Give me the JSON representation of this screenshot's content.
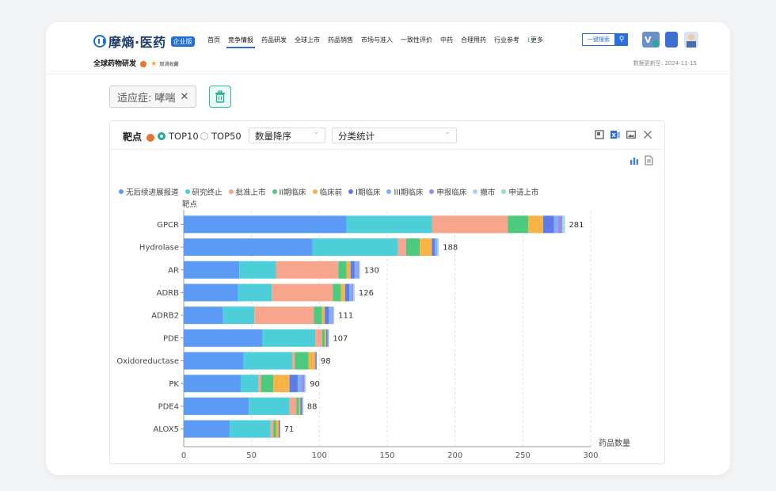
{
  "brand": {
    "name": "摩熵·医药",
    "badge": "企业版"
  },
  "nav": {
    "items": [
      "首页",
      "竞争情报",
      "药品研发",
      "全球上市",
      "药品销售",
      "市场与准入",
      "一致性评价",
      "中药",
      "合理用药",
      "行业参考"
    ],
    "more": "更多",
    "active_index": 1
  },
  "search": {
    "label": "一键搜索"
  },
  "subheader": {
    "title": "全球药物研发",
    "favorite": "取消收藏",
    "update_label": "数据更新至: 2024-11-15"
  },
  "filter": {
    "tag": "适应症: 哮喘"
  },
  "panel": {
    "title": "靶点",
    "radios": [
      "TOP10",
      "TOP50"
    ],
    "radio_selected": "TOP10",
    "sort_select": "数量降序",
    "stat_select": "分类统计"
  },
  "chart_data": {
    "type": "bar",
    "orientation": "horizontal",
    "stacked": true,
    "ylabel": "靶点",
    "xlabel": "药品数量",
    "xlim": [
      0,
      300
    ],
    "xticks": [
      0,
      50,
      100,
      150,
      200,
      250,
      300
    ],
    "categories": [
      "GPCR",
      "Hydrolase",
      "AR",
      "ADRB",
      "ADRB2",
      "PDE",
      "Oxidoreductase",
      "PK",
      "PDE4",
      "ALOX5"
    ],
    "totals": [
      281,
      188,
      130,
      126,
      111,
      107,
      98,
      90,
      88,
      71
    ],
    "legend_position": "top",
    "series": [
      {
        "name": "无后续进展报道",
        "color": "#5b9bf5",
        "values": [
          120,
          95,
          41,
          40,
          29,
          58,
          44,
          42,
          48,
          34
        ]
      },
      {
        "name": "研究终止",
        "color": "#4ccfd8",
        "values": [
          63,
          63,
          27,
          25,
          23,
          39,
          36,
          13,
          30,
          30
        ]
      },
      {
        "name": "批准上市",
        "color": "#f7a58c",
        "values": [
          56,
          6,
          46,
          45,
          44,
          5,
          2,
          2,
          5,
          2
        ]
      },
      {
        "name": "II期临床",
        "color": "#4ccb7e",
        "values": [
          15,
          10,
          6,
          6,
          6,
          2,
          10,
          9,
          2,
          2
        ]
      },
      {
        "name": "临床前",
        "color": "#f7b346",
        "values": [
          11,
          9,
          3,
          3,
          2,
          1,
          5,
          12,
          1,
          2
        ]
      },
      {
        "name": "I期临床",
        "color": "#5d7ce8",
        "values": [
          8,
          2,
          3,
          3,
          3,
          1,
          1,
          6,
          1,
          1
        ]
      },
      {
        "name": "III期临床",
        "color": "#7fb0f7",
        "values": [
          3,
          2,
          2,
          2,
          2,
          1,
          0,
          3,
          1,
          0
        ]
      },
      {
        "name": "申报临床",
        "color": "#9d8bea",
        "values": [
          3,
          0,
          1,
          1,
          1,
          0,
          0,
          2,
          0,
          0
        ]
      },
      {
        "name": "撤市",
        "color": "#a6d2f3",
        "values": [
          1,
          1,
          1,
          1,
          1,
          0,
          0,
          1,
          0,
          0
        ]
      },
      {
        "name": "申请上市",
        "color": "#8ee2b5",
        "values": [
          1,
          0,
          0,
          0,
          0,
          0,
          0,
          0,
          0,
          0
        ]
      }
    ]
  }
}
